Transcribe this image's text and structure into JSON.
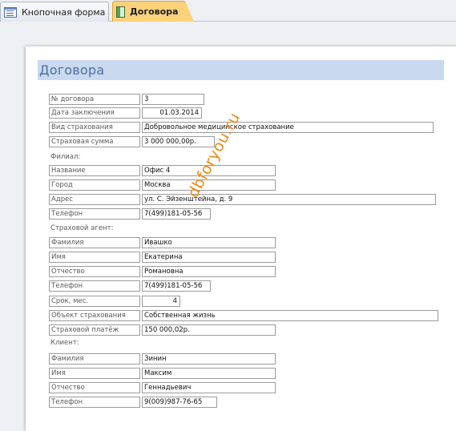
{
  "tabs": [
    {
      "label": "Кнопочная форма",
      "active": false,
      "icon": "form-icon"
    },
    {
      "label": "Договора",
      "active": true,
      "icon": "report-icon"
    }
  ],
  "report": {
    "title": "Договора",
    "contract": {
      "number_label": "№ договора",
      "number": "3",
      "date_label": "Дата заключения",
      "date": "01.03.2014",
      "type_label": "Вид страхования",
      "type": "Добровольное медицинское страхование",
      "sum_label": "Страховая сумма",
      "sum": "3 000 000,00р."
    },
    "branch": {
      "section": "Филиал:",
      "name_label": "Название",
      "name": "Офис 4",
      "city_label": "Город",
      "city": "Москва",
      "address_label": "Адрес",
      "address": "ул. С. Эйзенштейна, д. 9",
      "phone_label": "Телефон",
      "phone": "7(499)181-05-56"
    },
    "agent": {
      "section": "Страховой агент:",
      "last_label": "Фамилия",
      "last": "Ивашко",
      "first_label": "Имя",
      "first": "Екатерина",
      "middle_label": "Отчество",
      "middle": "Романовна",
      "phone_label": "Телефон",
      "phone": "7(499)181-05-56",
      "term_label": "Срок, мес.",
      "term": "4",
      "object_label": "Объект страхования",
      "object": "Собственная жизнь",
      "payment_label": "Страховой платёж",
      "payment": "150 000,02р."
    },
    "client": {
      "section": "Клиент:",
      "last_label": "Фамилия",
      "last": "Зинин",
      "first_label": "Имя",
      "first": "Максим",
      "middle_label": "Отчество",
      "middle": "Геннадьевич",
      "phone_label": "Телефон",
      "phone": "9(009)987-76-65"
    },
    "watermark": "dbforyou.ru"
  },
  "colors": {
    "active_tab": "#fbd27a",
    "title_band": "#c9d9ef",
    "title_text": "#4e6f9a",
    "watermark": "#f08a14"
  }
}
